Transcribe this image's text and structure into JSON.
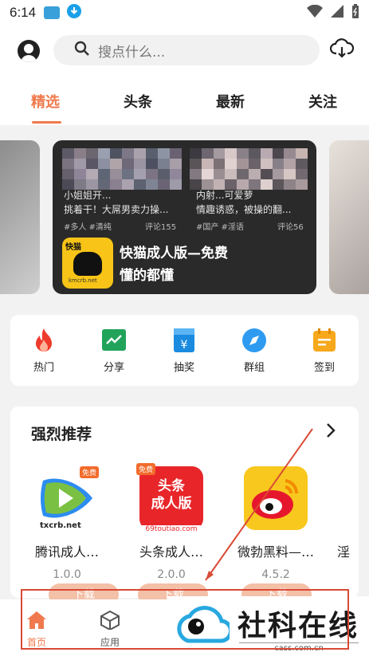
{
  "status_bar": {
    "time": "6:14"
  },
  "header": {
    "search_placeholder": "搜点什么...",
    "tabs": [
      {
        "label": "精选",
        "active": true
      },
      {
        "label": "头条",
        "active": false
      },
      {
        "label": "最新",
        "active": false
      },
      {
        "label": "关注",
        "active": false
      }
    ]
  },
  "banner": {
    "left_caption": "小姐姐开...\n挑着干！大屌男卖力操...",
    "left_tags": "#多人 #清纯",
    "left_comments": "评论155",
    "right_caption": "内射...可爱萝\n情趣诱惑，被操的翻...",
    "right_tags": "#国产 #淫语",
    "right_comments": "评论56",
    "promo_title": "快猫成人版—免费\n懂的都懂",
    "promo_logo_text": "快猫",
    "promo_url": "kmcrb.net"
  },
  "quick_links": [
    {
      "label": "热门",
      "icon": "flame-icon"
    },
    {
      "label": "分享",
      "icon": "chart-share-icon"
    },
    {
      "label": "抽奖",
      "icon": "lottery-icon"
    },
    {
      "label": "群组",
      "icon": "compass-icon"
    },
    {
      "label": "签到",
      "icon": "calendar-checkin-icon"
    }
  ],
  "recommend": {
    "title": "强烈推荐",
    "apps": [
      {
        "name": "腾讯成人…",
        "version": "1.0.0",
        "badge": "免费",
        "url": "txcrb.net"
      },
      {
        "name": "头条成人…",
        "version": "2.0.0",
        "badge": "免费",
        "url": "69toutiao.com",
        "logo_text": "头条\n成人版"
      },
      {
        "name": "微勃黑料—…",
        "version": "4.5.2"
      },
      {
        "name": "淫",
        "version": ""
      }
    ],
    "download_label": "下载"
  },
  "bottom_nav": [
    {
      "label": "首页",
      "active": true
    },
    {
      "label": "应用",
      "active": false
    }
  ],
  "watermark": {
    "text": "社科在线",
    "url": "cass.com.cn"
  },
  "colors": {
    "accent": "#f07a4e",
    "annotation_red": "#d94a35"
  }
}
